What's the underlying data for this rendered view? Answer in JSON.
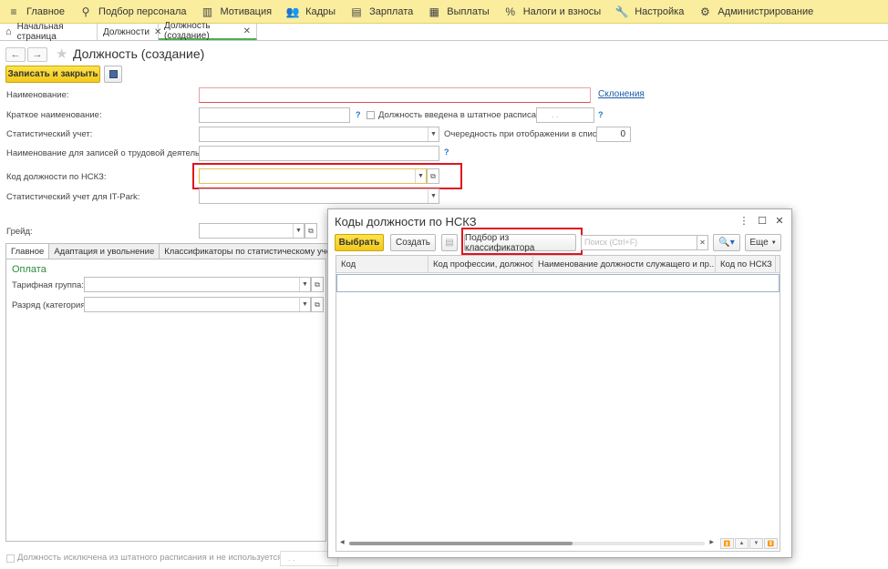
{
  "menu": [
    {
      "icon": "hamburger-icon",
      "glyph": "≡",
      "label": "Главное"
    },
    {
      "icon": "person-search-icon",
      "glyph": "⚲",
      "label": "Подбор персонала"
    },
    {
      "icon": "motivation-icon",
      "glyph": "▥",
      "label": "Мотивация"
    },
    {
      "icon": "people-icon",
      "glyph": "👥",
      "label": "Кадры"
    },
    {
      "icon": "salary-icon",
      "glyph": "▤",
      "label": "Зарплата"
    },
    {
      "icon": "payments-icon",
      "glyph": "▦",
      "label": "Выплаты"
    },
    {
      "icon": "percent-icon",
      "glyph": "%",
      "label": "Налоги и взносы"
    },
    {
      "icon": "wrench-icon",
      "glyph": "🔧",
      "label": "Настройка"
    },
    {
      "icon": "gear-icon",
      "glyph": "⚙",
      "label": "Администрирование"
    }
  ],
  "tabs": [
    {
      "label": "Начальная страница",
      "closable": false
    },
    {
      "label": "Должности",
      "closable": true
    },
    {
      "label": "Должность (создание)",
      "closable": true
    }
  ],
  "form": {
    "title": "Должность (создание)",
    "save_close": "Записать и закрыть",
    "name_label": "Наименование:",
    "declension_link": "Склонения",
    "short_name_label": "Краткое наименование:",
    "q": "?",
    "staff_check_label": "Должность введена в штатное расписание",
    "staff_date": " .  . ",
    "stat_label": "Статистический учет:",
    "order_label": "Очередность при отображении в списках:",
    "order_value": "0",
    "labor_label": "Наименование для записей о трудовой деятельности:",
    "nskz_label": "Код должности по НСКЗ:",
    "itpark_label": "Статистический учет для IT-Park:",
    "grade_label": "Грейд:",
    "inner_tabs": [
      "Главное",
      "Адаптация и увольнение",
      "Классификаторы по статистическому учету"
    ],
    "payment_section": "Оплата",
    "tariff_label": "Тарифная группа:",
    "category_label": "Разряд (категория):",
    "footer_check": "Должность исключена из штатного расписания и не используется после",
    "footer_date": " .  . "
  },
  "dialog": {
    "title": "Коды должности по НСКЗ",
    "select_btn": "Выбрать",
    "create_btn": "Создать",
    "classifier_btn": "Подбор из классификатора",
    "search_placeholder": "Поиск (Ctrl+F)",
    "more_btn": "Еще",
    "columns": [
      "Код",
      "Код профессии, должности",
      "Наименование должности служащего и пр...",
      "Код по НСКЗ"
    ]
  }
}
